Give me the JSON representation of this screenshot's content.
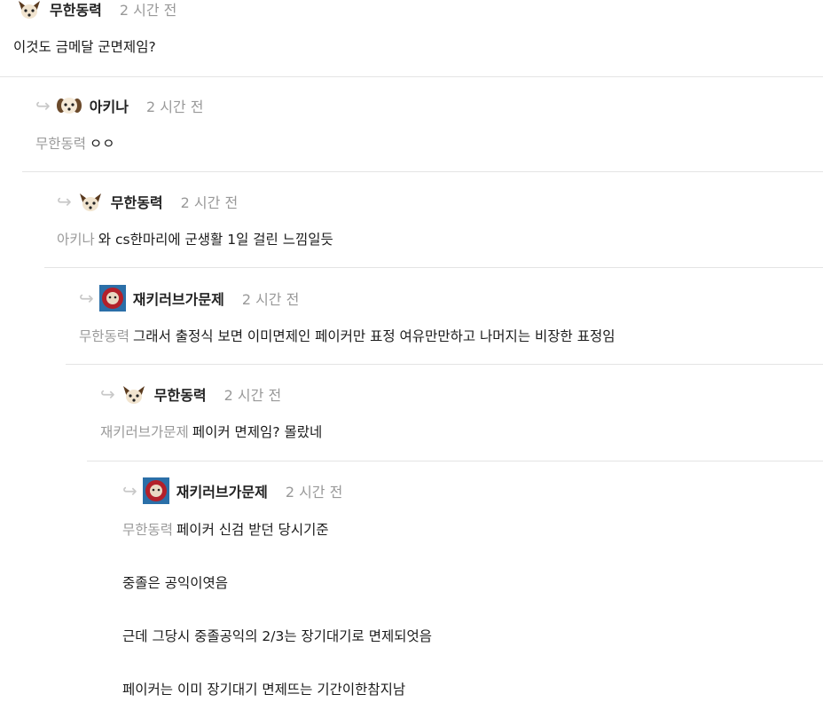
{
  "comments": [
    {
      "author": "무한동력",
      "time": "2 시간 전",
      "mention": "",
      "text": "이것도 금메달 군면제임?"
    },
    {
      "author": "아키나",
      "time": "2 시간 전",
      "mention": "무한동력",
      "text": "ㅇㅇ"
    },
    {
      "author": "무한동력",
      "time": "2 시간 전",
      "mention": "아키나",
      "text": "와 cs한마리에 군생활 1일 걸린 느낌일듯"
    },
    {
      "author": "재키러브가문제",
      "time": "2 시간 전",
      "mention": "무한동력",
      "text": "그래서 출정식 보면 이미면제인 페이커만 표정 여유만만하고 나머지는 비장한 표정임"
    },
    {
      "author": "무한동력",
      "time": "2 시간 전",
      "mention": "재키러브가문제",
      "text": "페이커 면제임? 몰랐네"
    },
    {
      "author": "재키러브가문제",
      "time": "2 시간 전",
      "mention": "무한동력",
      "text": "페이커 신검 받던 당시기준",
      "paragraphs": [
        "중졸은 공익이엿음",
        "근데 그당시 중졸공익의 2/3는 장기대기로 면제되엇음",
        "페이커는 이미 장기대기 면제뜨는 기간이한참지남"
      ]
    }
  ],
  "icons": {
    "reply": "reply-arrow-icon",
    "avatar_dog": "dog-avatar-icon",
    "avatar_puppy": "puppy-avatar-icon",
    "avatar_red": "red-character-avatar-icon"
  },
  "colors": {
    "mention": "#9a9a9a",
    "time": "#999999",
    "divider": "#e4e4e4"
  }
}
